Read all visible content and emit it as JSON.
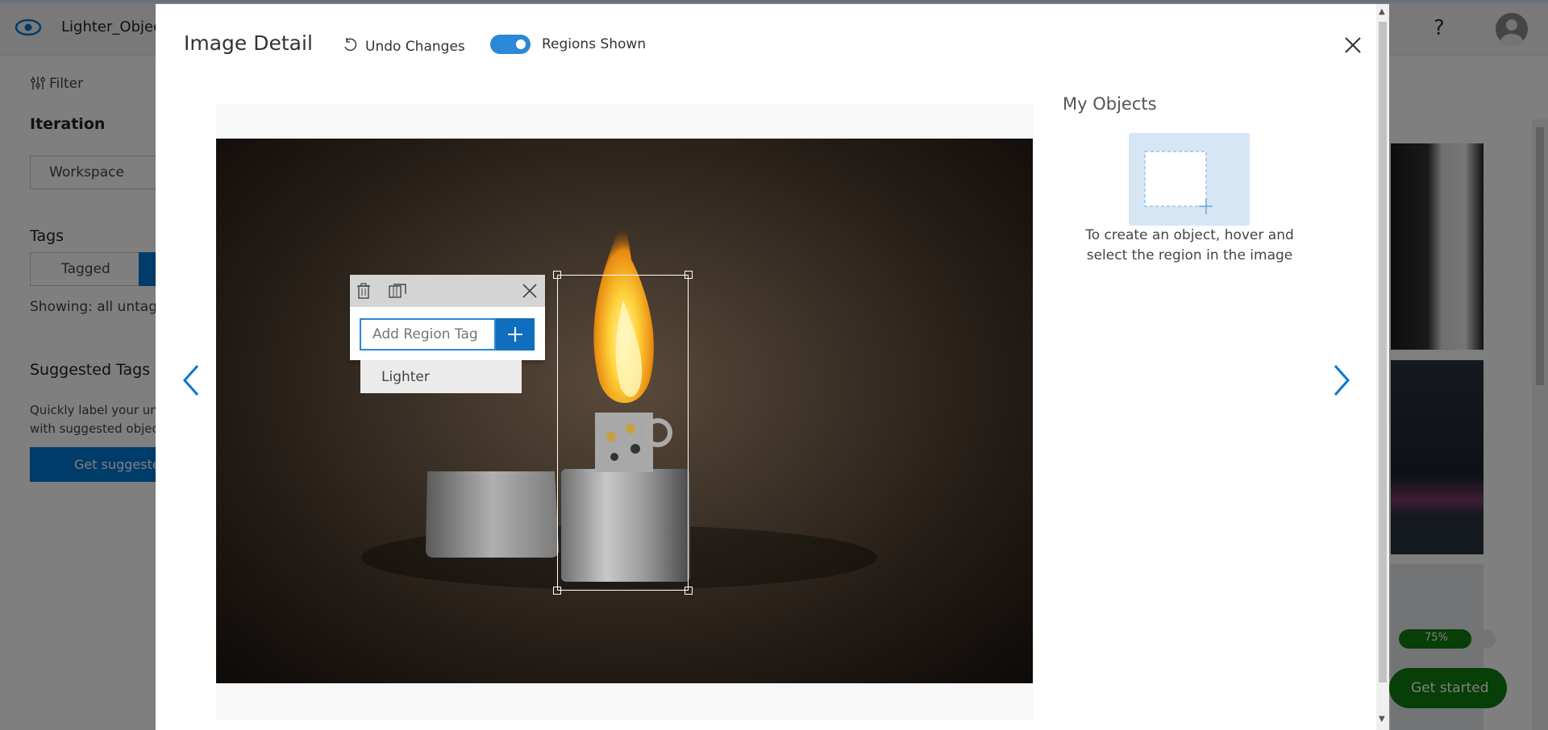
{
  "app": {
    "project_name": "Lighter_Object",
    "help_icon": "help-icon",
    "filter_label": "Filter",
    "iteration_heading": "Iteration",
    "iteration_value": "Workspace",
    "tags_heading": "Tags",
    "tagged_label": "Tagged",
    "showing_text": "Showing: all untagg",
    "suggested_tags_heading": "Suggested Tags",
    "suggested_desc_line1": "Quickly label your unt",
    "suggested_desc_line2": "with suggested object",
    "get_suggested_label": "Get suggestec",
    "progress_label": "75%",
    "progress_value": 0.75,
    "get_started_label": "Get started"
  },
  "modal": {
    "title": "Image Detail",
    "undo_label": "Undo Changes",
    "regions_label": "Regions Shown",
    "regions_on": true,
    "tag_input_placeholder": "Add Region Tag",
    "suggestion": "Lighter",
    "my_objects_title": "My Objects",
    "my_objects_hint": "To create an object, hover and select the region in the image"
  },
  "colors": {
    "accent": "#2b88d8",
    "primary_button": "#106ebe",
    "get_started": "#107c10",
    "progress": "#107c10"
  }
}
